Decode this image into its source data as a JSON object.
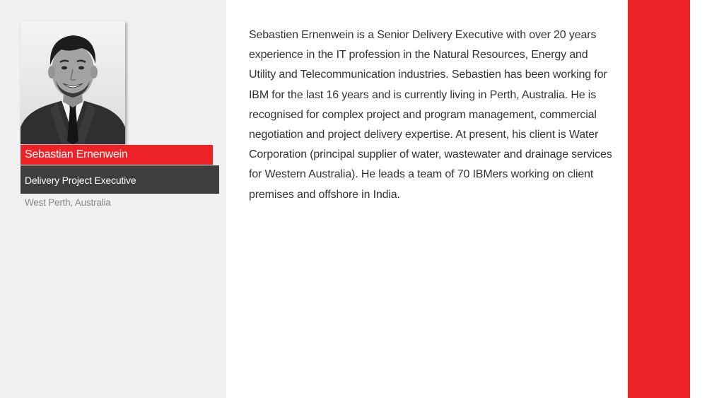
{
  "profile": {
    "name": "Sebastian Ernenwein",
    "title": "Delivery Project Executive",
    "location": "West Perth, Australia",
    "bio": "Sebastien Ernenwein is a Senior Delivery Executive with over 20 years experience in the IT profession in the Natural Resources, Energy and Utility and Telecommunication industries. Sebastien has been working for IBM for the last 16 years and is currently living in Perth, Australia. He is recognised for complex project and program management, commercial negotiation and project delivery expertise. At present, his client is Water Corporation (principal supplier of water, wastewater and drainage services for Western Australia). He leads a team of 70 IBMers working on client premises and offshore in India."
  },
  "colors": {
    "accent": "#ec2227",
    "panel": "#f1f1f1",
    "title_bar": "#3e3e3e",
    "location_text": "#8a8a8a",
    "body_text": "#333333"
  }
}
